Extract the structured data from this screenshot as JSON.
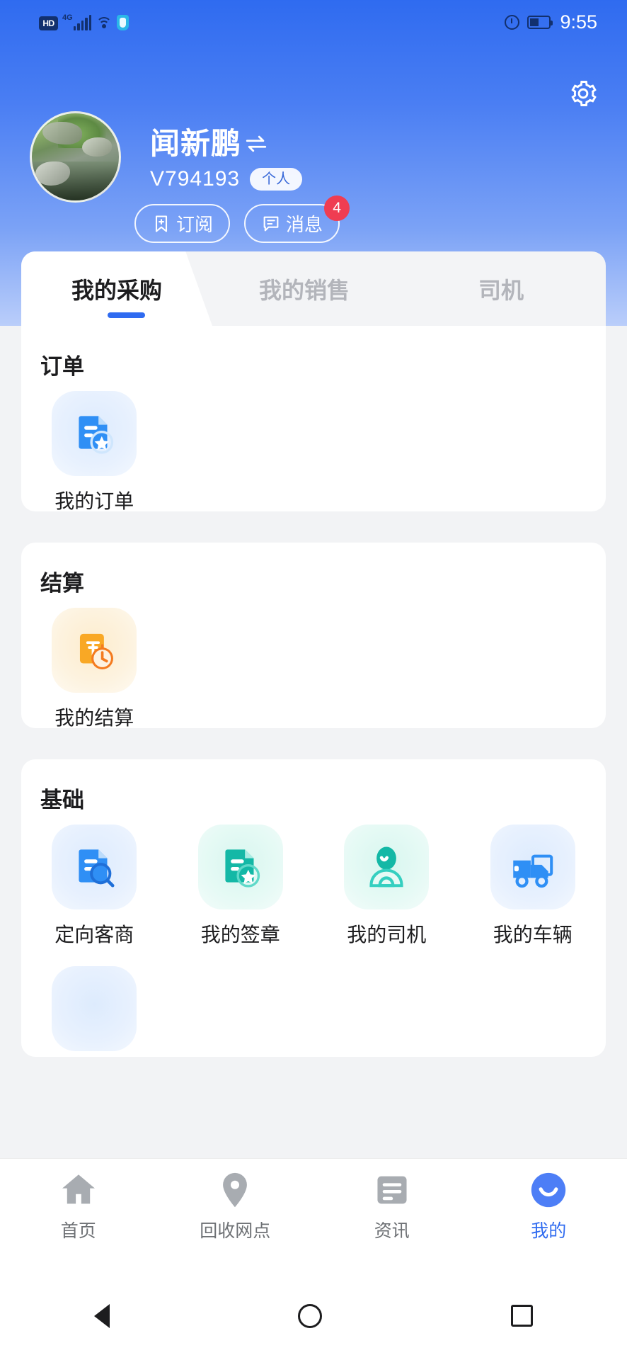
{
  "statusbar": {
    "hd_label": "HD",
    "network_label": "4G",
    "time": "9:55",
    "icons": [
      "hd-icon",
      "signal-icon",
      "wifi-icon",
      "shield-icon",
      "alarm-icon",
      "battery-icon"
    ]
  },
  "header": {
    "settings_icon": "gear-icon",
    "avatar": "user-avatar",
    "username": "闻新鹏",
    "switch_account_icon": "swap-arrows-icon",
    "user_id": "V794193",
    "account_type_badge": "个人",
    "subscribe_button": {
      "label": "订阅",
      "icon": "bookmark-plus-icon"
    },
    "message_button": {
      "label": "消息",
      "icon": "message-icon",
      "badge": "4"
    }
  },
  "tabs": [
    {
      "label": "我的采购",
      "active": true
    },
    {
      "label": "我的销售",
      "active": false
    },
    {
      "label": "司机",
      "active": false
    }
  ],
  "sections": [
    {
      "title": "订单",
      "items": [
        {
          "label": "我的订单",
          "icon": "document-star-icon",
          "theme": "blue"
        }
      ]
    },
    {
      "title": "结算",
      "items": [
        {
          "label": "我的结算",
          "icon": "yuan-clock-icon",
          "theme": "orange"
        }
      ]
    },
    {
      "title": "基础",
      "items": [
        {
          "label": "定向客商",
          "icon": "document-search-icon",
          "theme": "blue"
        },
        {
          "label": "我的签章",
          "icon": "document-seal-icon",
          "theme": "teal"
        },
        {
          "label": "我的司机",
          "icon": "driver-person-icon",
          "theme": "teal"
        },
        {
          "label": "我的车辆",
          "icon": "truck-icon",
          "theme": "blue"
        }
      ]
    }
  ],
  "bottom_nav": [
    {
      "label": "首页",
      "icon": "home-icon",
      "active": false
    },
    {
      "label": "回收网点",
      "icon": "location-pin-icon",
      "active": false
    },
    {
      "label": "资讯",
      "icon": "news-icon",
      "active": false
    },
    {
      "label": "我的",
      "icon": "profile-smiley-icon",
      "active": true
    }
  ],
  "system_nav": [
    {
      "icon": "back-triangle-icon"
    },
    {
      "icon": "home-circle-icon"
    },
    {
      "icon": "recents-square-icon"
    }
  ],
  "colors": {
    "accent": "#2f6bf0",
    "header_gradient_top": "#2f6bf0",
    "badge_red": "#ef3d52",
    "page_bg": "#f2f3f5"
  }
}
